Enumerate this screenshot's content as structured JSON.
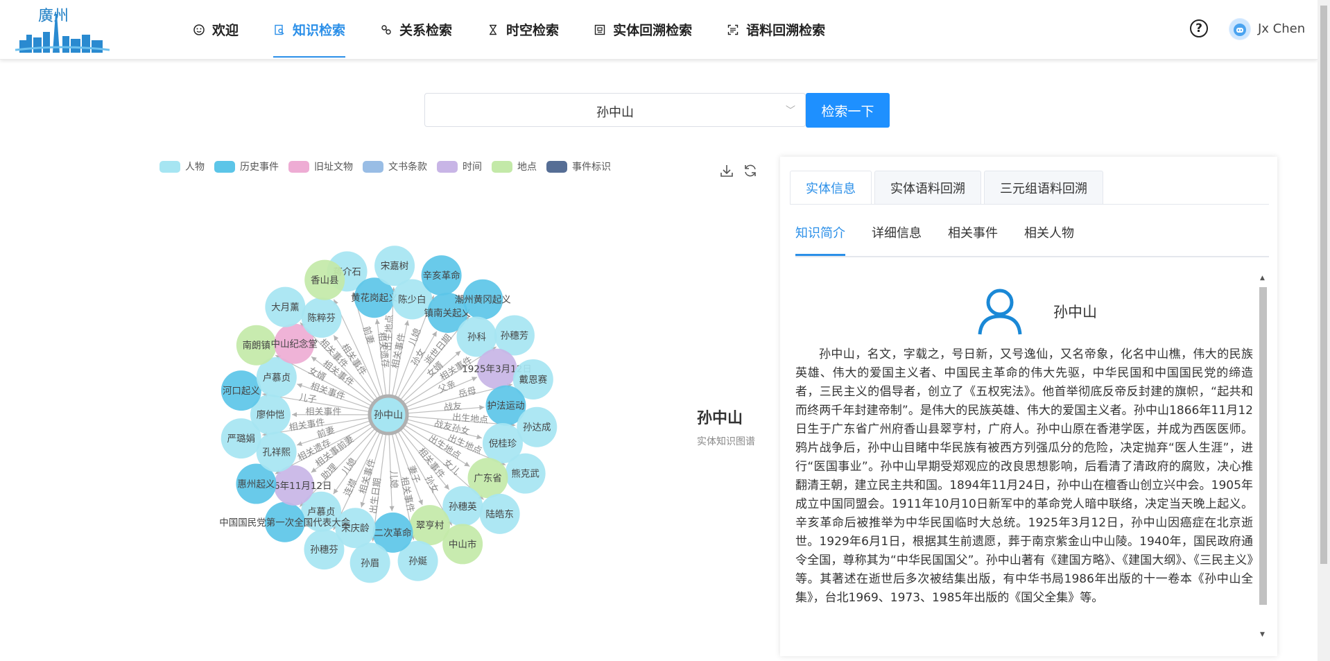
{
  "header": {
    "logo_text": "廣州",
    "nav": [
      {
        "label": "欢迎",
        "icon": "smile-icon",
        "active": false
      },
      {
        "label": "知识检索",
        "icon": "search-doc-icon",
        "active": true
      },
      {
        "label": "关系检索",
        "icon": "link-icon",
        "active": false
      },
      {
        "label": "时空检索",
        "icon": "hourglass-icon",
        "active": false
      },
      {
        "label": "实体回溯检索",
        "icon": "entity-icon",
        "active": false
      },
      {
        "label": "语料回溯检索",
        "icon": "scan-icon",
        "active": false
      }
    ],
    "help": "?",
    "username": "Jx Chen"
  },
  "search": {
    "value": "孙中山",
    "button_label": "检索一下"
  },
  "legend": [
    {
      "label": "人物",
      "color": "#a6e5f2"
    },
    {
      "label": "历史事件",
      "color": "#5cc5e8"
    },
    {
      "label": "旧址文物",
      "color": "#eeacd4"
    },
    {
      "label": "文书条款",
      "color": "#99bde5"
    },
    {
      "label": "时间",
      "color": "#c8b5e6"
    },
    {
      "label": "地点",
      "color": "#c3e9a8"
    },
    {
      "label": "事件标识",
      "color": "#566e95"
    }
  ],
  "graph": {
    "center": "孙中山",
    "nodes": [
      {
        "label": "蒋介石",
        "type": "人物"
      },
      {
        "label": "黄花岗起义",
        "type": "历史事件"
      },
      {
        "label": "宋嘉树",
        "type": "人物"
      },
      {
        "label": "陈少白",
        "type": "人物"
      },
      {
        "label": "辛亥革命",
        "type": "历史事件"
      },
      {
        "label": "镇南关起义",
        "type": "历史事件"
      },
      {
        "label": "潮州黄冈起义",
        "type": "历史事件"
      },
      {
        "label": "孙科",
        "type": "人物"
      },
      {
        "label": "孙穗芳",
        "type": "人物"
      },
      {
        "label": "1925年3月12日",
        "type": "时间"
      },
      {
        "label": "戴恩赛",
        "type": "人物"
      },
      {
        "label": "护法运动",
        "type": "历史事件"
      },
      {
        "label": "孙达成",
        "type": "人物"
      },
      {
        "label": "倪桂珍",
        "type": "人物"
      },
      {
        "label": "熊克武",
        "type": "人物"
      },
      {
        "label": "广东省",
        "type": "地点"
      },
      {
        "label": "陆皓东",
        "type": "人物"
      },
      {
        "label": "孙穗英",
        "type": "人物"
      },
      {
        "label": "中山市",
        "type": "地点"
      },
      {
        "label": "翠亨村",
        "type": "地点"
      },
      {
        "label": "孙娫",
        "type": "人物"
      },
      {
        "label": "二次革命",
        "type": "历史事件"
      },
      {
        "label": "孙眉",
        "type": "人物"
      },
      {
        "label": "宋庆龄",
        "type": "人物"
      },
      {
        "label": "孙穗芬",
        "type": "人物"
      },
      {
        "label": "卢慕贞",
        "type": "人物"
      },
      {
        "label": "中国国民党第一次全国代表大会",
        "type": "历史事件"
      },
      {
        "label": "1866年11月12日",
        "type": "时间"
      },
      {
        "label": "惠州起义",
        "type": "历史事件"
      },
      {
        "label": "孔祥熙",
        "type": "人物"
      },
      {
        "label": "严璐娟",
        "type": "人物"
      },
      {
        "label": "廖仲恺",
        "type": "人物"
      },
      {
        "label": "河口起义",
        "type": "历史事件"
      },
      {
        "label": "卢慕贞",
        "type": "人物"
      },
      {
        "label": "南朗镇",
        "type": "地点"
      },
      {
        "label": "中山纪念堂",
        "type": "旧址文物"
      },
      {
        "label": "大月薰",
        "type": "人物"
      },
      {
        "label": "陈粹芬",
        "type": "人物"
      },
      {
        "label": "香山县",
        "type": "地点"
      }
    ],
    "edge_labels": [
      "前妻",
      "相关遗存",
      "出生地点",
      "相关事件",
      "儿媳",
      "孙女",
      "逝世日期",
      "女婿",
      "相关事件",
      "父亲",
      "岳母",
      "战友",
      "出生地点",
      "战友孙女",
      "出生地点",
      "出生地点",
      "女儿",
      "相关事件",
      "孙女",
      "妻子",
      "相关事件",
      "儿媳",
      "出生日期",
      "相关事件",
      "连襟",
      "儿媳",
      "助理",
      "相关事前妻",
      "相关遗存",
      "前妻",
      "相关事件",
      "相关事件",
      "儿子",
      "相关事件",
      "女婿",
      "相关事件",
      "相关事件",
      "相关事件"
    ]
  },
  "entity": {
    "title": "孙中山",
    "subtitle": "实体知识图谱"
  },
  "panel": {
    "tabs": [
      "实体信息",
      "实体语料回溯",
      "三元组语料回溯"
    ],
    "subtabs": [
      "知识简介",
      "详细信息",
      "相关事件",
      "相关人物"
    ],
    "name": "孙中山",
    "description": "孙中山，名文，字载之，号日新，又号逸仙，又名帝象，化名中山樵，伟大的民族英雄、伟大的爱国主义者、中国民主革命的伟大先驱，中华民国和中国国民党的缔造者，三民主义的倡导者，创立了《五权宪法》。他首举彻底反帝反封建的旗帜，“起共和而终两千年封建帝制”。是伟大的民族英雄、伟大的爱国主义者。孙中山1866年11月12日生于广东省广州府香山县翠亨村，广府人。孙中山原在香港学医，并成为西医医师。鸦片战争后，孙中山目睹中华民族有被西方列强瓜分的危险，决定抛弃“医人生涯”，进行“医国事业”。孙中山早期受郑观应的改良思想影响，后看清了清政府的腐败，决心推翻清王朝，建立民主共和国。1894年11月24日，孙中山在檀香山创立兴中会。1905年成立中国同盟会。1911年10月10日新军中的革命党人暗中联络，决定当天晚上起义。辛亥革命后被推举为中华民国临时大总统。1925年3月12日，孙中山因癌症在北京逝世。1929年6月1日，根据其生前遗愿，葬于南京紫金山中山陵。1940年，国民政府通令全国，尊称其为“中华民国国父”。孙中山著有《建国方略》、《建国大纲》、《三民主义》等。其著述在逝世后多次被结集出版，有中华书局1986年出版的十一卷本《孙中山全集》，台北1969、1973、1985年出版的《国父全集》等。"
  }
}
